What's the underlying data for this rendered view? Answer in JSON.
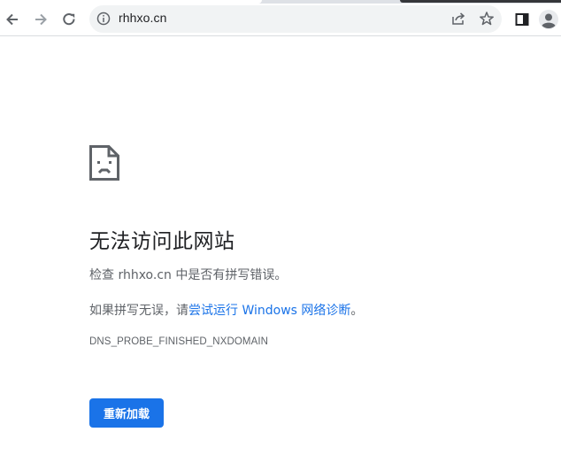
{
  "browser": {
    "url": "rhhxo.cn",
    "icons": {
      "back": "back-arrow-icon",
      "forward": "forward-arrow-icon",
      "reload": "reload-icon",
      "site_info": "info-icon",
      "share": "share-icon",
      "bookmark": "star-icon",
      "side_panel": "side-panel-icon",
      "profile": "avatar-icon"
    }
  },
  "error_page": {
    "icon": "sad-page-icon",
    "title": "无法访问此网站",
    "line1": "检查 rhhxo.cn 中是否有拼写错误。",
    "line2_prefix": "如果拼写无误，请",
    "line2_link": "尝试运行 Windows 网络诊断",
    "line2_suffix": "。",
    "error_code": "DNS_PROBE_FINISHED_NXDOMAIN",
    "reload_button": "重新加载"
  },
  "colors": {
    "accent": "#1a73e8",
    "text_primary": "#202124",
    "text_secondary": "#5f6368",
    "omnibox_bg": "#f1f3f4"
  }
}
